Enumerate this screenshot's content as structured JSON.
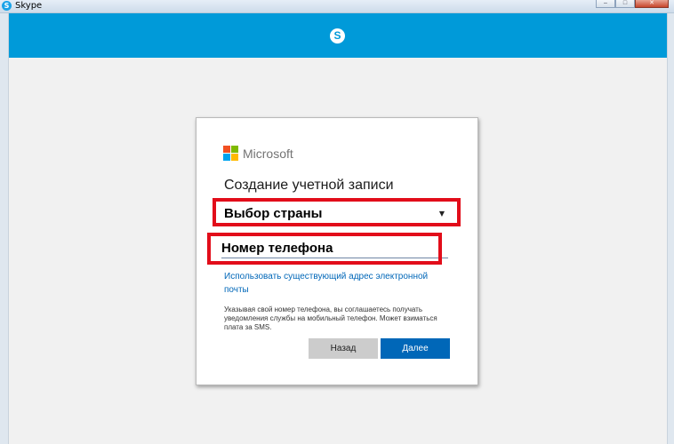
{
  "window": {
    "title": "Skype"
  },
  "header": {
    "logo_glyph": "S",
    "color": "#009ad9"
  },
  "card": {
    "brand": "Microsoft",
    "brand_colors": [
      "#f25022",
      "#7fba00",
      "#00a4ef",
      "#ffb900"
    ],
    "heading": "Создание учетной записи",
    "country_label": "Выбор страны",
    "country_arrow": "▼",
    "phone_placeholder": "Номер телефона",
    "email_link": "Использовать существующий адрес электронной почты",
    "disclaimer": "Указывая свой номер телефона, вы соглашаетесь получать уведомления службы на мобильный телефон. Может взиматься плата за SMS.",
    "back_label": "Назад",
    "next_label": "Далее"
  },
  "highlight_color": "#e20d1a"
}
